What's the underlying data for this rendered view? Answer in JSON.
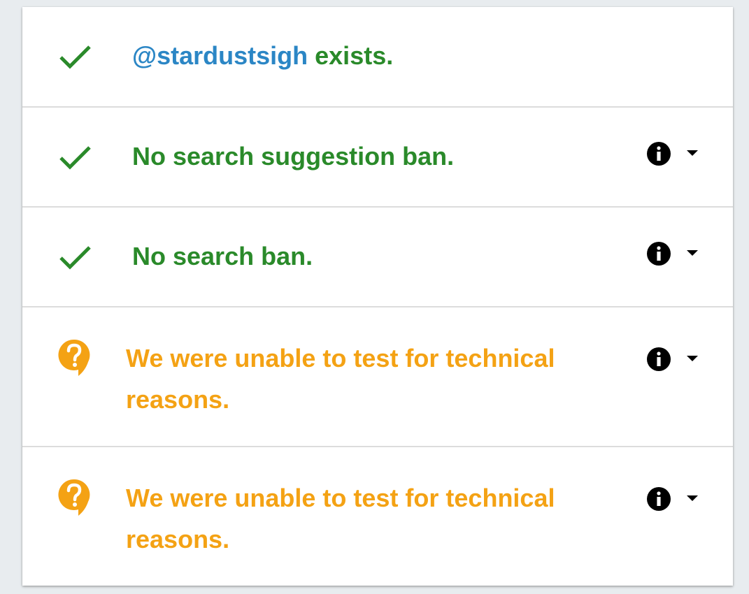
{
  "results": [
    {
      "status": "ok",
      "status_icon": "check-icon",
      "handle": "@stardustsigh",
      "text": " exists."
    },
    {
      "status": "ok",
      "status_icon": "check-icon",
      "text": "No search suggestion ban.",
      "info_icon": "info-icon",
      "expand_icon": "caret-down-icon"
    },
    {
      "status": "ok",
      "status_icon": "check-icon",
      "text": "No search ban.",
      "info_icon": "info-icon",
      "expand_icon": "caret-down-icon"
    },
    {
      "status": "unknown",
      "status_icon": "question-bubble-icon",
      "text": "We were unable to test for technical reasons.",
      "info_icon": "info-icon",
      "expand_icon": "caret-down-icon"
    },
    {
      "status": "unknown",
      "status_icon": "question-bubble-icon",
      "text": "We were unable to test for technical reasons.",
      "info_icon": "info-icon",
      "expand_icon": "caret-down-icon"
    }
  ],
  "colors": {
    "ok": "#2a8a2a",
    "unknown": "#f4a214",
    "handle": "#2b86c5",
    "divider": "#dcdcdc"
  }
}
